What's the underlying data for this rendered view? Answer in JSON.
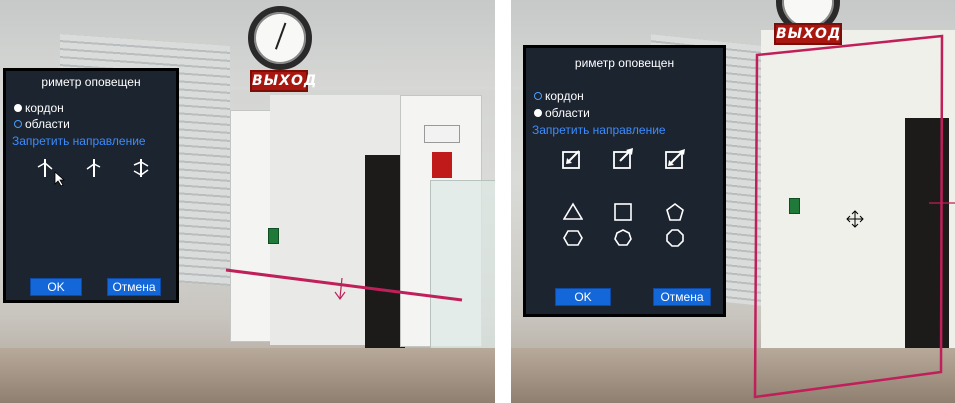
{
  "colors": {
    "dialog_bg": "#1c2430",
    "accent_blue": "#3b8cff",
    "button_blue": "#1367d9",
    "line_magenta": "#c01f5a",
    "exit_red": "#a8170f"
  },
  "left_panel": {
    "exit_sign": "ВЫХОД",
    "dialog": {
      "title": "риметр оповещен",
      "options": [
        {
          "label": "кордон",
          "selected": true
        },
        {
          "label": "области",
          "selected": false
        }
      ],
      "section_label": "Запретить направление",
      "direction_icons": [
        "bidirectional-arrow-icon",
        "one-way-arrow-icon",
        "cross-arrow-icon"
      ],
      "ok_label": "OK",
      "cancel_label": "Отмена"
    }
  },
  "right_panel": {
    "exit_sign": "ВЫХОД",
    "dialog": {
      "title": "риметр оповещен",
      "options": [
        {
          "label": "кордон",
          "selected": false
        },
        {
          "label": "области",
          "selected": true
        }
      ],
      "section_label": "Запретить направление",
      "direction_icons": [
        "enter-region-icon",
        "exit-region-icon",
        "both-directions-region-icon"
      ],
      "shape_icons": [
        "triangle-icon",
        "square-icon",
        "pentagon-icon",
        "hexagon-icon",
        "heptagon-icon",
        "octagon-icon"
      ],
      "ok_label": "OK",
      "cancel_label": "Отмена"
    }
  }
}
